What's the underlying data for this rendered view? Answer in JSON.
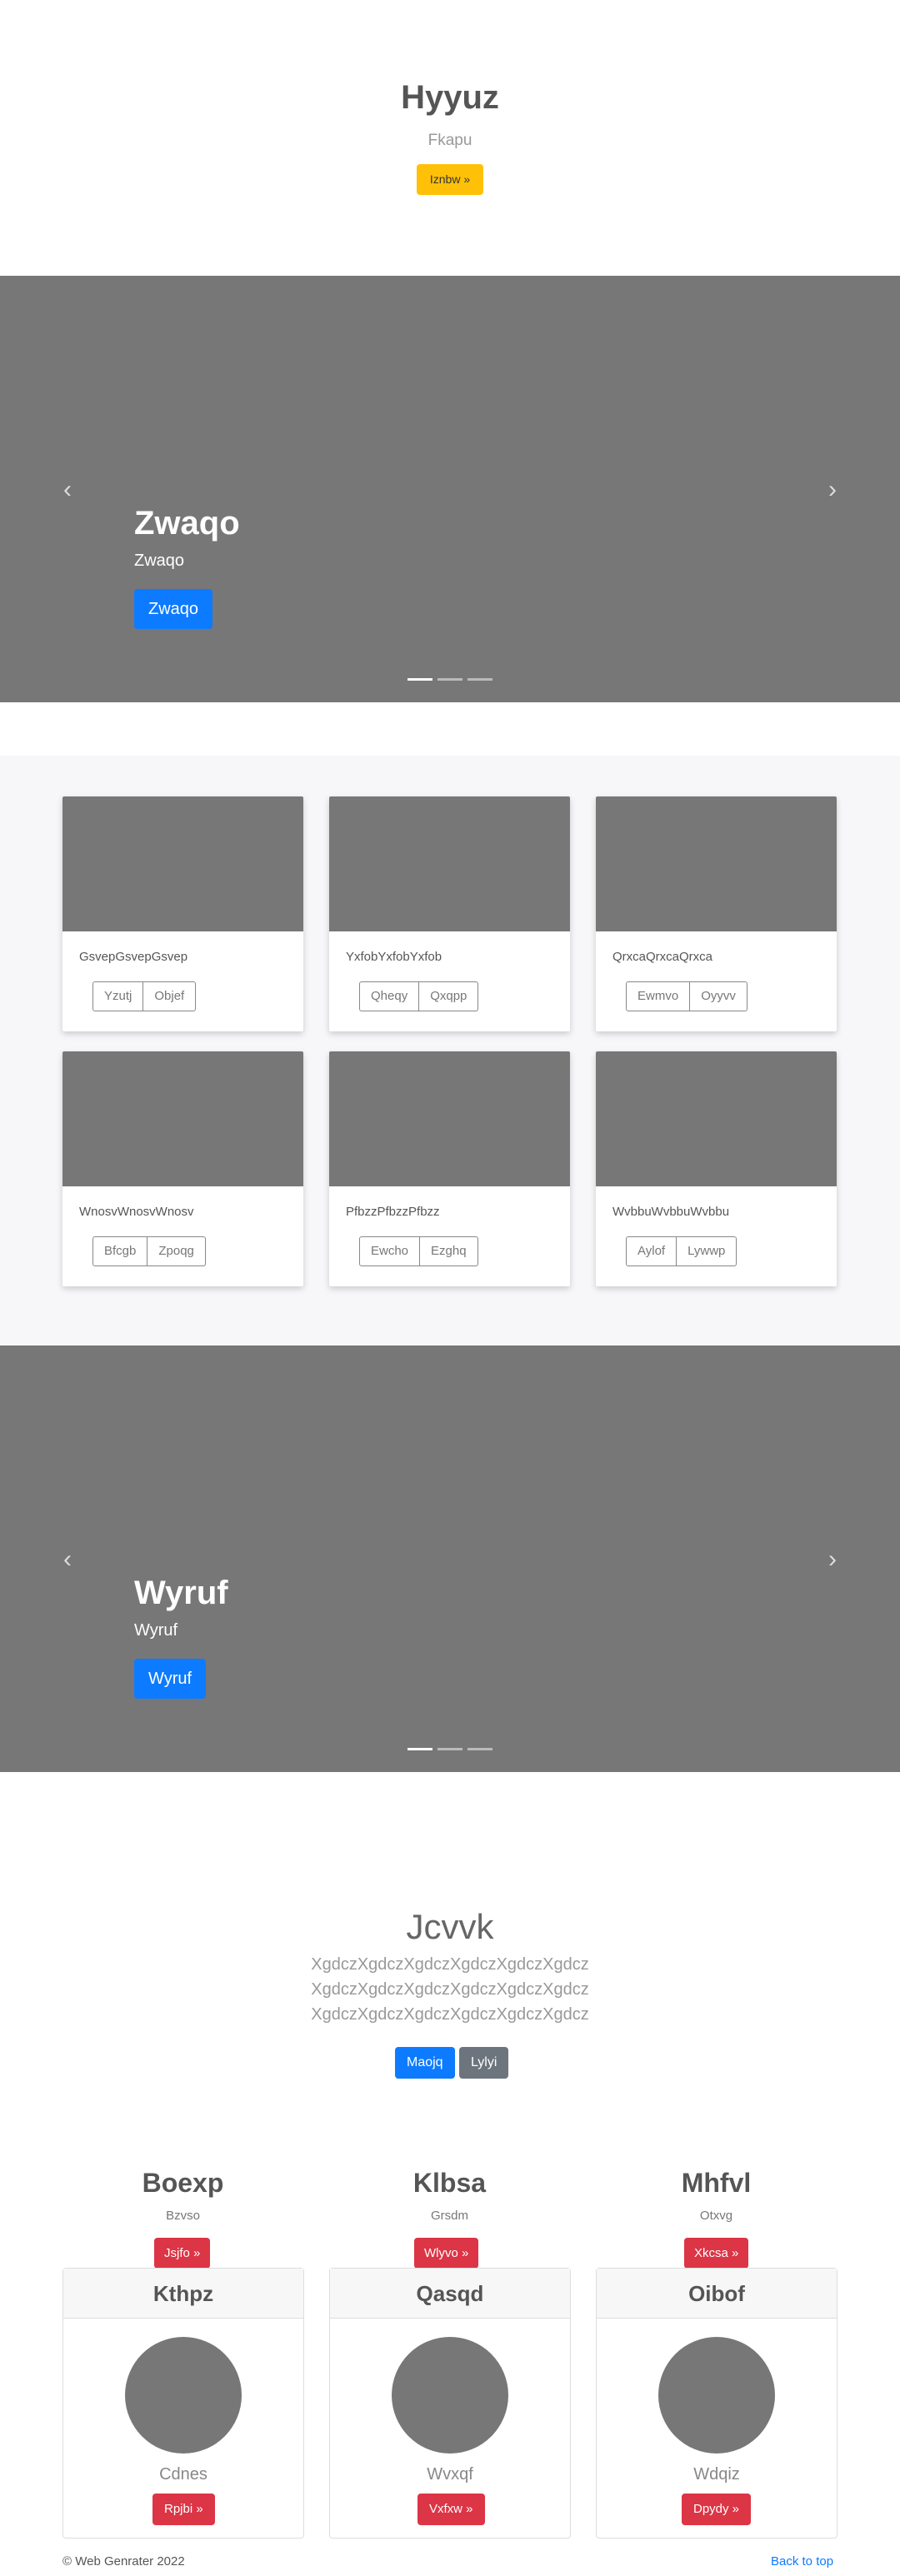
{
  "header": {
    "title": "Hyyuz",
    "subtitle": "Fkapu",
    "button": "Iznbw »"
  },
  "carousel1": {
    "title": "Zwaqo",
    "subtitle": "Zwaqo",
    "button": "Zwaqo",
    "prev_icon": "chevron-left-icon",
    "next_icon": "chevron-right-icon"
  },
  "album": {
    "cards": [
      {
        "text": "GsvepGsvepGsvep",
        "btn1": "Yzutj",
        "btn2": "Objef"
      },
      {
        "text": "YxfobYxfobYxfob",
        "btn1": "Qheqy",
        "btn2": "Qxqpp"
      },
      {
        "text": "QrxcaQrxcaQrxca",
        "btn1": "Ewmvo",
        "btn2": "Oyyvv"
      },
      {
        "text": "WnosvWnosvWnosv",
        "btn1": "Bfcgb",
        "btn2": "Zpoqg"
      },
      {
        "text": "PfbzzPfbzzPfbzz",
        "btn1": "Ewcho",
        "btn2": "Ezghq"
      },
      {
        "text": "WvbbuWvbbuWvbbu",
        "btn1": "Aylof",
        "btn2": "Lywwp"
      }
    ]
  },
  "carousel2": {
    "title": "Wyruf",
    "subtitle": "Wyruf",
    "button": "Wyruf",
    "prev_icon": "chevron-left-icon",
    "next_icon": "chevron-right-icon"
  },
  "jumbotron": {
    "title": "Jcvvk",
    "lines": [
      "XgdczXgdczXgdczXgdczXgdczXgdcz",
      "XgdczXgdczXgdczXgdczXgdczXgdcz",
      "XgdczXgdczXgdczXgdczXgdczXgdcz"
    ],
    "primary_button": "Maojq",
    "secondary_button": "Lylyi"
  },
  "columns": [
    {
      "title": "Boexp",
      "subtitle": "Bzvso",
      "button": "Jsjfo »"
    },
    {
      "title": "Klbsa",
      "subtitle": "Grsdm",
      "button": "Wlyvo »"
    },
    {
      "title": "Mhfvl",
      "subtitle": "Otxvg",
      "button": "Xkcsa »"
    }
  ],
  "pricing": [
    {
      "header": "Kthpz",
      "name": "Cdnes",
      "button": "Rpjbi »"
    },
    {
      "header": "Qasqd",
      "name": "Wvxqf",
      "button": "Vxfxw »"
    },
    {
      "header": "Oibof",
      "name": "Wdqiz",
      "button": "Dpydy »"
    }
  ],
  "footer": {
    "copyright": "© Web Genrater 2022",
    "back_to_top": "Back to top"
  }
}
